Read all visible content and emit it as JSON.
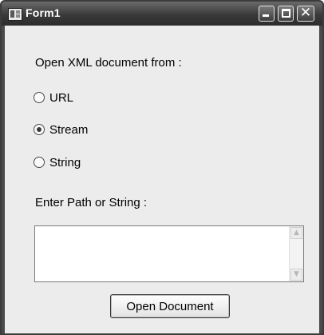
{
  "window": {
    "title": "Form1",
    "icon": "form-app-icon",
    "controls": [
      "minimize-icon",
      "maximize-icon",
      "close-icon"
    ],
    "close_glyph": "✕"
  },
  "form": {
    "source_prompt": "Open XML document from :",
    "source_options": [
      {
        "label": "URL",
        "selected": false
      },
      {
        "label": "Stream",
        "selected": true
      },
      {
        "label": "String",
        "selected": false
      }
    ],
    "path_prompt": "Enter Path or String :",
    "path_value": "",
    "scroll_up_glyph": "▲",
    "scroll_down_glyph": "▼",
    "open_button_label": "Open Document"
  }
}
